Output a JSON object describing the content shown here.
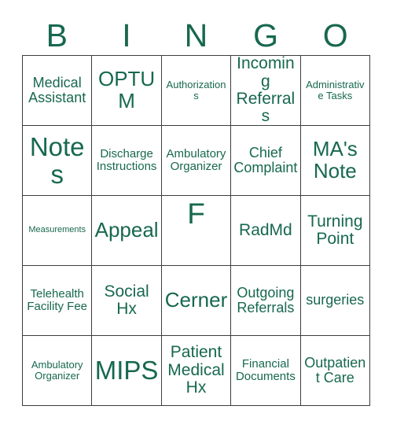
{
  "header": {
    "letters": [
      "B",
      "I",
      "N",
      "G",
      "O"
    ]
  },
  "colors": {
    "text": "#17684f",
    "grid_line": "#3d3d3d",
    "cell_background": "#ffffff",
    "page_background": "#ffffff"
  },
  "grid": {
    "columns": 5,
    "rows": 5,
    "cells": [
      {
        "text": "Medical Assistant",
        "size": "md"
      },
      {
        "text": "OPTUM",
        "size": "xl"
      },
      {
        "text": "Authorizations",
        "size": "xs"
      },
      {
        "text": "Incoming Referrals",
        "size": "lg"
      },
      {
        "text": "Administrative Tasks",
        "size": "xs"
      },
      {
        "text": "Notes",
        "size": "xxl"
      },
      {
        "text": "Discharge Instructions",
        "size": "sm"
      },
      {
        "text": "Ambulatory Organizer",
        "size": "sm"
      },
      {
        "text": "Chief Complaint",
        "size": "md"
      },
      {
        "text": "MA's Note",
        "size": "xl"
      },
      {
        "text": "Measurements",
        "size": "xxs"
      },
      {
        "text": "Appeal",
        "size": "xl"
      },
      {
        "text": "F",
        "size": "free",
        "free_space": true
      },
      {
        "text": "RadMd",
        "size": "lg"
      },
      {
        "text": "Turning Point",
        "size": "lg"
      },
      {
        "text": "Telehealth Facility Fee",
        "size": "sm"
      },
      {
        "text": "Social Hx",
        "size": "lg"
      },
      {
        "text": "Cerner",
        "size": "xl"
      },
      {
        "text": "Outgoing Referrals",
        "size": "md"
      },
      {
        "text": "surgeries",
        "size": "md"
      },
      {
        "text": "Ambulatory Organizer",
        "size": "xs"
      },
      {
        "text": "MIPS",
        "size": "xxl"
      },
      {
        "text": "Patient Medical Hx",
        "size": "lg"
      },
      {
        "text": "Financial Documents",
        "size": "sm"
      },
      {
        "text": "Outpatient Care",
        "size": "md"
      }
    ]
  }
}
